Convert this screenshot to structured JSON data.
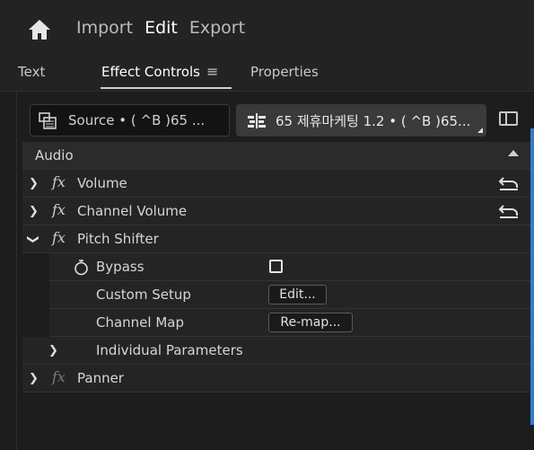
{
  "topnav": {
    "import": "Import",
    "edit": "Edit",
    "export": "Export"
  },
  "tabs": {
    "text": "Text",
    "effect_controls": "Effect Controls",
    "menu_glyph": "≡",
    "properties": "Properties"
  },
  "source": {
    "label": "Source • ( ^B )65 ...",
    "sequence": "65 제휴마케팅 1.2 • ( ^B )65..."
  },
  "section": {
    "audio": "Audio"
  },
  "effects": {
    "volume": "Volume",
    "channel_volume": "Channel Volume",
    "pitch_shifter": "Pitch Shifter",
    "bypass": "Bypass",
    "custom_setup": "Custom Setup",
    "edit_button": "Edit...",
    "channel_map": "Channel Map",
    "remap_button": "Re-map...",
    "individual_parameters": "Individual Parameters",
    "panner": "Panner"
  },
  "glyphs": {
    "fx": "fx",
    "chevron_right": "❯",
    "chevron_down": "❯"
  }
}
